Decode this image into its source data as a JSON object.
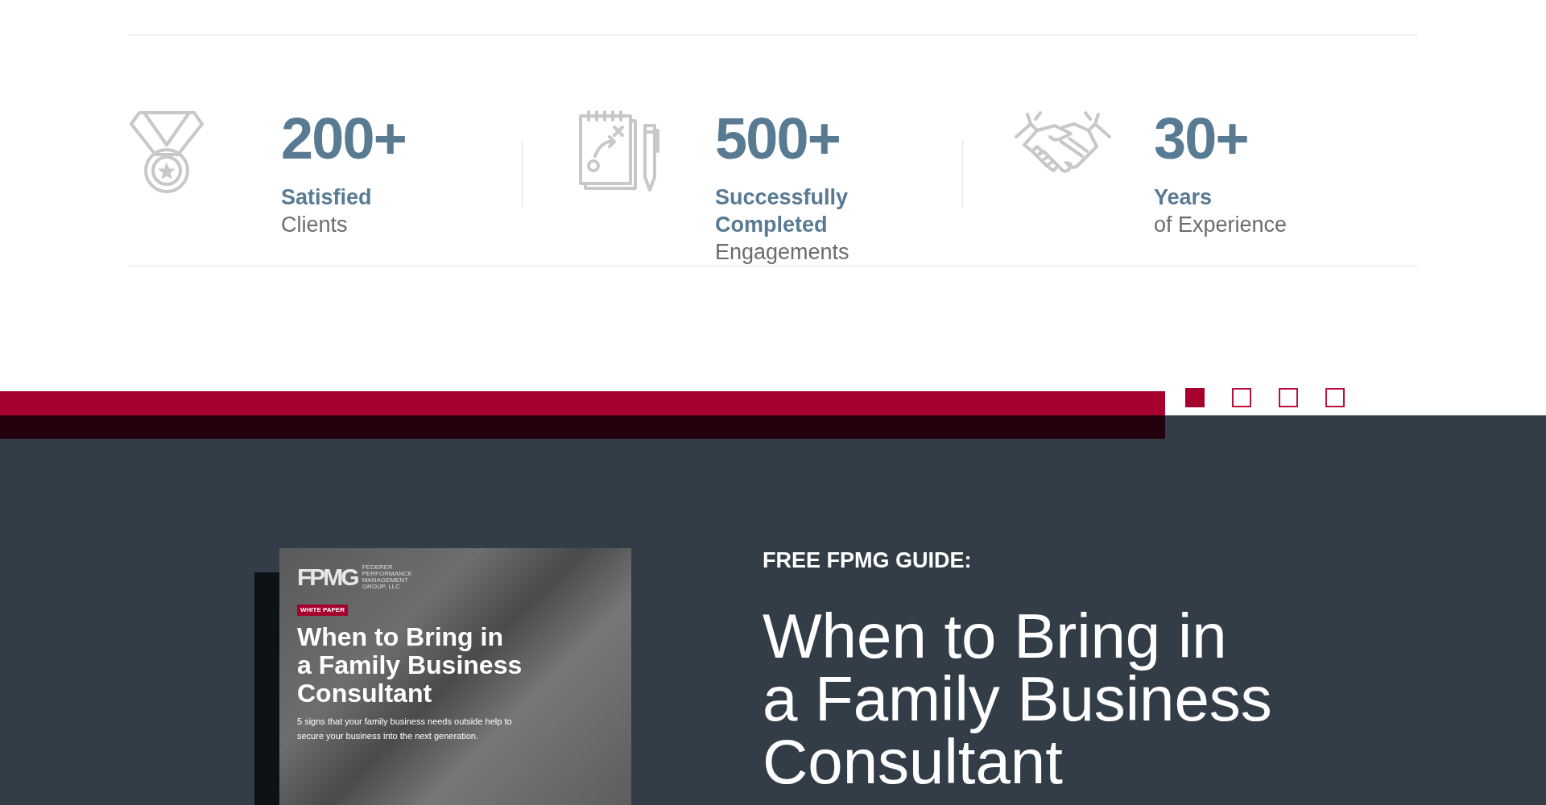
{
  "stats": [
    {
      "kind": "medal",
      "number": "200+",
      "label_lines": [
        "Satisfied"
      ],
      "sub_lines": [
        "Clients"
      ]
    },
    {
      "kind": "notepad",
      "number": "500+",
      "label_lines": [
        "Successfully",
        "Completed"
      ],
      "sub_lines": [
        "Engagements"
      ]
    },
    {
      "kind": "handshake",
      "number": "30+",
      "label_lines": [
        "Years"
      ],
      "sub_lines": [
        "of Experience"
      ]
    }
  ],
  "slider_dots": [
    {
      "selected": true
    },
    {
      "selected": false
    },
    {
      "selected": false
    },
    {
      "selected": false
    }
  ],
  "guide": {
    "cover": {
      "logo": "FPMG",
      "company_lines": [
        "FEDERER",
        "PERFORMANCE",
        "MANAGEMENT",
        "GROUP, LLC"
      ],
      "tag": "WHITE PAPER",
      "title_lines": [
        "When to Bring in",
        "a Family Business",
        "Consultant"
      ],
      "subtitle_lines": [
        "5 signs that your family business needs outside help to",
        "secure your business into the next generation."
      ]
    },
    "eyebrow": "FREE FPMG GUIDE:",
    "title_lines": [
      "When to Bring in",
      "a Family Business",
      "Consultant"
    ]
  }
}
